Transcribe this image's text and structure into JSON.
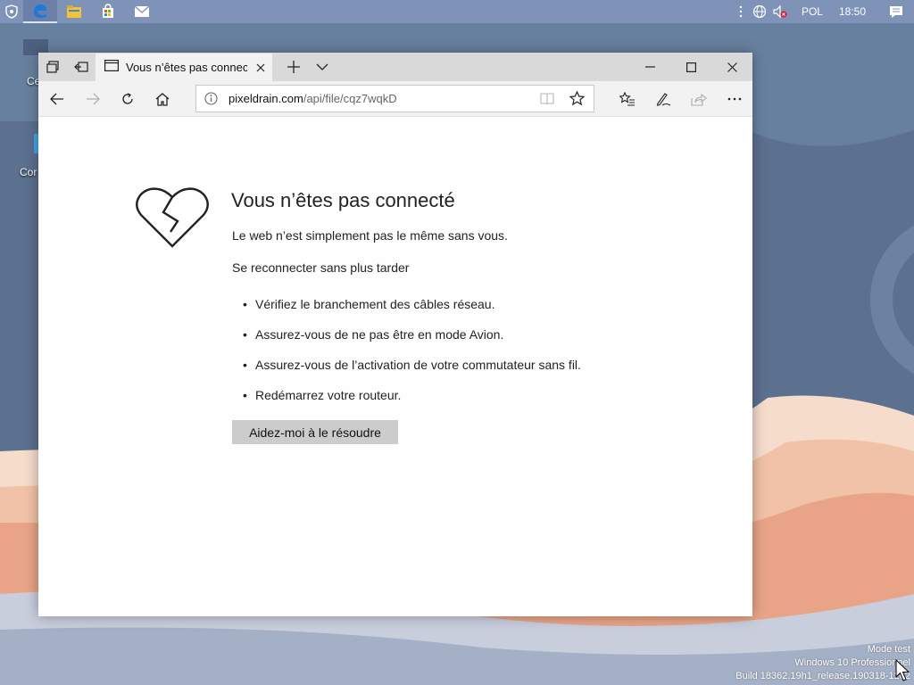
{
  "taskbar": {
    "language": "POL",
    "time": "18:50",
    "apps": [
      "shield-icon",
      "edge-icon",
      "file-explorer-icon",
      "store-icon",
      "mail-icon"
    ]
  },
  "desktop": {
    "icons": [
      {
        "label": "Ce"
      },
      {
        "label": "Cor"
      }
    ]
  },
  "watermark": {
    "line1": "Mode test",
    "line2": "Windows 10 Professionnel",
    "line3": "Build 18362.19h1_release.190318-1202"
  },
  "browser": {
    "tab_title": "Vous n’êtes pas connecté",
    "address": {
      "host": "pixeldrain.com",
      "path": "/api/file/cqz7wqkD"
    }
  },
  "error_page": {
    "title": "Vous n’êtes pas connecté",
    "subtitle": "Le web n’est simplement pas le même sans vous.",
    "reconnect": "Se reconnecter sans plus tarder",
    "tips": [
      "Vérifiez le branchement des câbles réseau.",
      "Assurez-vous de ne pas être en mode Avion.",
      "Assurez-vous de l’activation de votre commutateur sans fil.",
      "Redémarrez votre routeur."
    ],
    "help_button": "Aidez-moi à le résoudre"
  },
  "colors": {
    "taskbar": "#7f93b8",
    "wallpaper_blue": "#5a6f8f",
    "wallpaper_peach": "#f2c3a8",
    "wallpaper_salmon": "#e9a184",
    "help_button_bg": "#cccccc"
  }
}
